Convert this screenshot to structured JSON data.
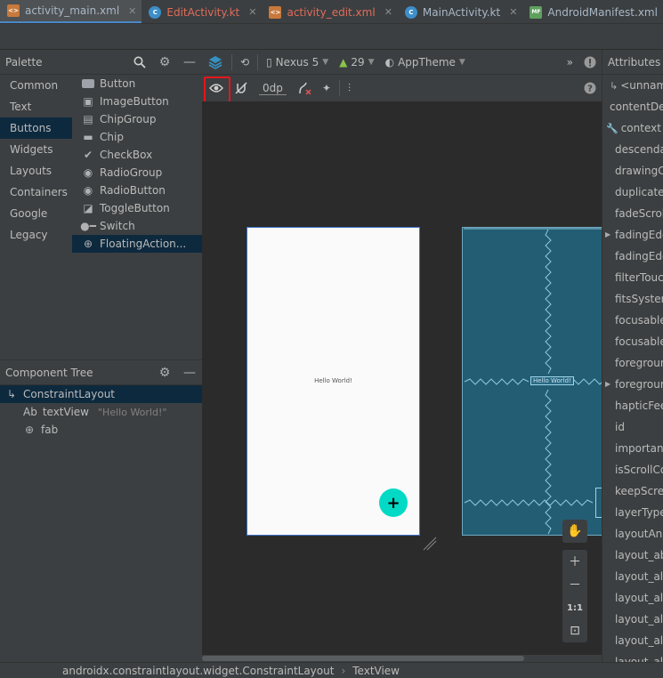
{
  "tabs": [
    {
      "label": "activity_main.xml",
      "type": "xml",
      "active": true
    },
    {
      "label": "EditActivity.kt",
      "type": "kt",
      "red": true
    },
    {
      "label": "activity_edit.xml",
      "type": "xml",
      "red": true
    },
    {
      "label": "MainActivity.kt",
      "type": "kt"
    },
    {
      "label": "AndroidManifest.xml",
      "type": "mf"
    }
  ],
  "palette": {
    "title": "Palette",
    "categories": [
      "Common",
      "Text",
      "Buttons",
      "Widgets",
      "Layouts",
      "Containers",
      "Google",
      "Legacy"
    ],
    "selected_category": "Buttons",
    "items": [
      "Button",
      "ImageButton",
      "ChipGroup",
      "Chip",
      "CheckBox",
      "RadioGroup",
      "RadioButton",
      "ToggleButton",
      "Switch",
      "FloatingAction..."
    ]
  },
  "component_tree": {
    "title": "Component Tree",
    "root": "ConstraintLayout",
    "children": [
      {
        "prefix": "Ab",
        "name": "textView",
        "hint": "\"Hello World!\""
      },
      {
        "name": "fab"
      }
    ]
  },
  "toolbar": {
    "device": "Nexus 5",
    "api": "29",
    "theme": "AppTheme",
    "default_margin": "0dp",
    "overflow": "»"
  },
  "canvas": {
    "hello_text": "Hello World!",
    "zoom_actual": "1:1"
  },
  "attributes": {
    "title": "Attributes",
    "rows": [
      {
        "label": "<unnamed>",
        "style": "top"
      },
      {
        "label": "contentDescription",
        "style": "top"
      },
      {
        "label": "context",
        "style": "wrench"
      },
      {
        "label": "descendantFocusability"
      },
      {
        "label": "drawingCacheQuality"
      },
      {
        "label": "duplicateParentState"
      },
      {
        "label": "fadeScrollbars"
      },
      {
        "label": "fadingEdge",
        "style": "caret"
      },
      {
        "label": "fadingEdgeLength"
      },
      {
        "label": "filterTouchesWhenObscured"
      },
      {
        "label": "fitsSystemWindows"
      },
      {
        "label": "focusable"
      },
      {
        "label": "focusableInTouchMode"
      },
      {
        "label": "foreground"
      },
      {
        "label": "foregroundTint",
        "style": "caret"
      },
      {
        "label": "hapticFeedbackEnabled"
      },
      {
        "label": "id"
      },
      {
        "label": "importantForAccessibility"
      },
      {
        "label": "isScrollContainer"
      },
      {
        "label": "keepScreenOn"
      },
      {
        "label": "layerType"
      },
      {
        "label": "layoutAnimation"
      },
      {
        "label": "layout_above"
      },
      {
        "label": "layout_alignBaseline"
      },
      {
        "label": "layout_alignBottom"
      },
      {
        "label": "layout_alignEnd"
      },
      {
        "label": "layout_alignLeft"
      },
      {
        "label": "layout_alignParentBottom"
      }
    ]
  },
  "status": {
    "path": "androidx.constraintlayout.widget.ConstraintLayout",
    "selected": "TextView"
  }
}
